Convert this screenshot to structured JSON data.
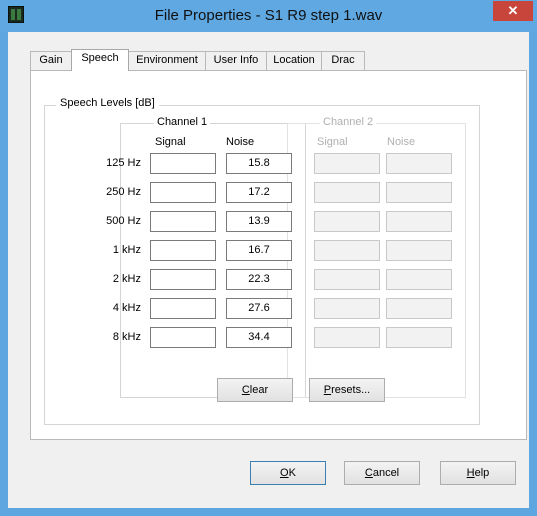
{
  "window": {
    "title": "File Properties - S1 R9 step 1.wav",
    "close_glyph": "✕"
  },
  "tabs": [
    "Gain",
    "Speech",
    "Environment",
    "User Info",
    "Location",
    "Drac"
  ],
  "active_tab": "Speech",
  "speech": {
    "group_label": "Speech Levels [dB]",
    "channel1": {
      "label": "Channel 1",
      "signal_header": "Signal",
      "noise_header": "Noise"
    },
    "channel2": {
      "label": "Channel 2",
      "signal_header": "Signal",
      "noise_header": "Noise"
    },
    "rows": [
      {
        "freq": "125 Hz",
        "ch1_signal": "",
        "ch1_noise": "15.8",
        "ch2_signal": "",
        "ch2_noise": ""
      },
      {
        "freq": "250 Hz",
        "ch1_signal": "",
        "ch1_noise": "17.2",
        "ch2_signal": "",
        "ch2_noise": ""
      },
      {
        "freq": "500 Hz",
        "ch1_signal": "",
        "ch1_noise": "13.9",
        "ch2_signal": "",
        "ch2_noise": ""
      },
      {
        "freq": "1 kHz",
        "ch1_signal": "",
        "ch1_noise": "16.7",
        "ch2_signal": "",
        "ch2_noise": ""
      },
      {
        "freq": "2 kHz",
        "ch1_signal": "",
        "ch1_noise": "22.3",
        "ch2_signal": "",
        "ch2_noise": ""
      },
      {
        "freq": "4 kHz",
        "ch1_signal": "",
        "ch1_noise": "27.6",
        "ch2_signal": "",
        "ch2_noise": ""
      },
      {
        "freq": "8 kHz",
        "ch1_signal": "",
        "ch1_noise": "34.4",
        "ch2_signal": "",
        "ch2_noise": ""
      }
    ],
    "clear_button": {
      "mnemonic": "C",
      "rest": "lear"
    },
    "presets_button": {
      "mnemonic": "P",
      "rest": "resets..."
    }
  },
  "buttons": {
    "ok": {
      "mnemonic": "O",
      "rest": "K"
    },
    "cancel": {
      "mnemonic": "C",
      "rest": "ancel"
    },
    "help": {
      "mnemonic": "H",
      "rest": "elp"
    }
  },
  "colors": {
    "titlebar": "#5fa8e2",
    "close": "#c8453c"
  }
}
